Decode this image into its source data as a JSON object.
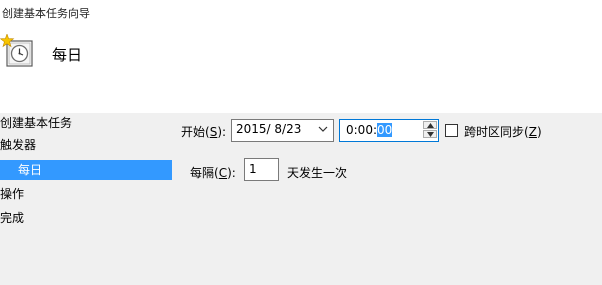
{
  "window": {
    "title": "创建基本任务向导"
  },
  "header": {
    "icon": "clock-with-star-icon",
    "title": "每日"
  },
  "nav": {
    "items": [
      {
        "label": "创建基本任务"
      },
      {
        "label": "触发器"
      },
      {
        "label": "每日"
      },
      {
        "label": "操作"
      },
      {
        "label": "完成"
      }
    ],
    "selected": "每日"
  },
  "form": {
    "start": {
      "label": "开始",
      "accel_open": "(",
      "accel_key": "S",
      "accel_close": "):",
      "date": "2015/  8/23",
      "time_prefix": "0:00:",
      "time_selected": "00"
    },
    "sync": {
      "label": "跨时区同步",
      "accel_open": "(",
      "accel_key": "Z",
      "accel_close": ")",
      "checked": false
    },
    "recur": {
      "label": "每隔",
      "accel_open": "(",
      "accel_key": "C",
      "accel_close": "):",
      "value": "1",
      "suffix": "天发生一次"
    }
  },
  "colors": {
    "selection": "#3399ff",
    "content_bg": "#f0f0f0",
    "focus_border": "#0078d7"
  }
}
